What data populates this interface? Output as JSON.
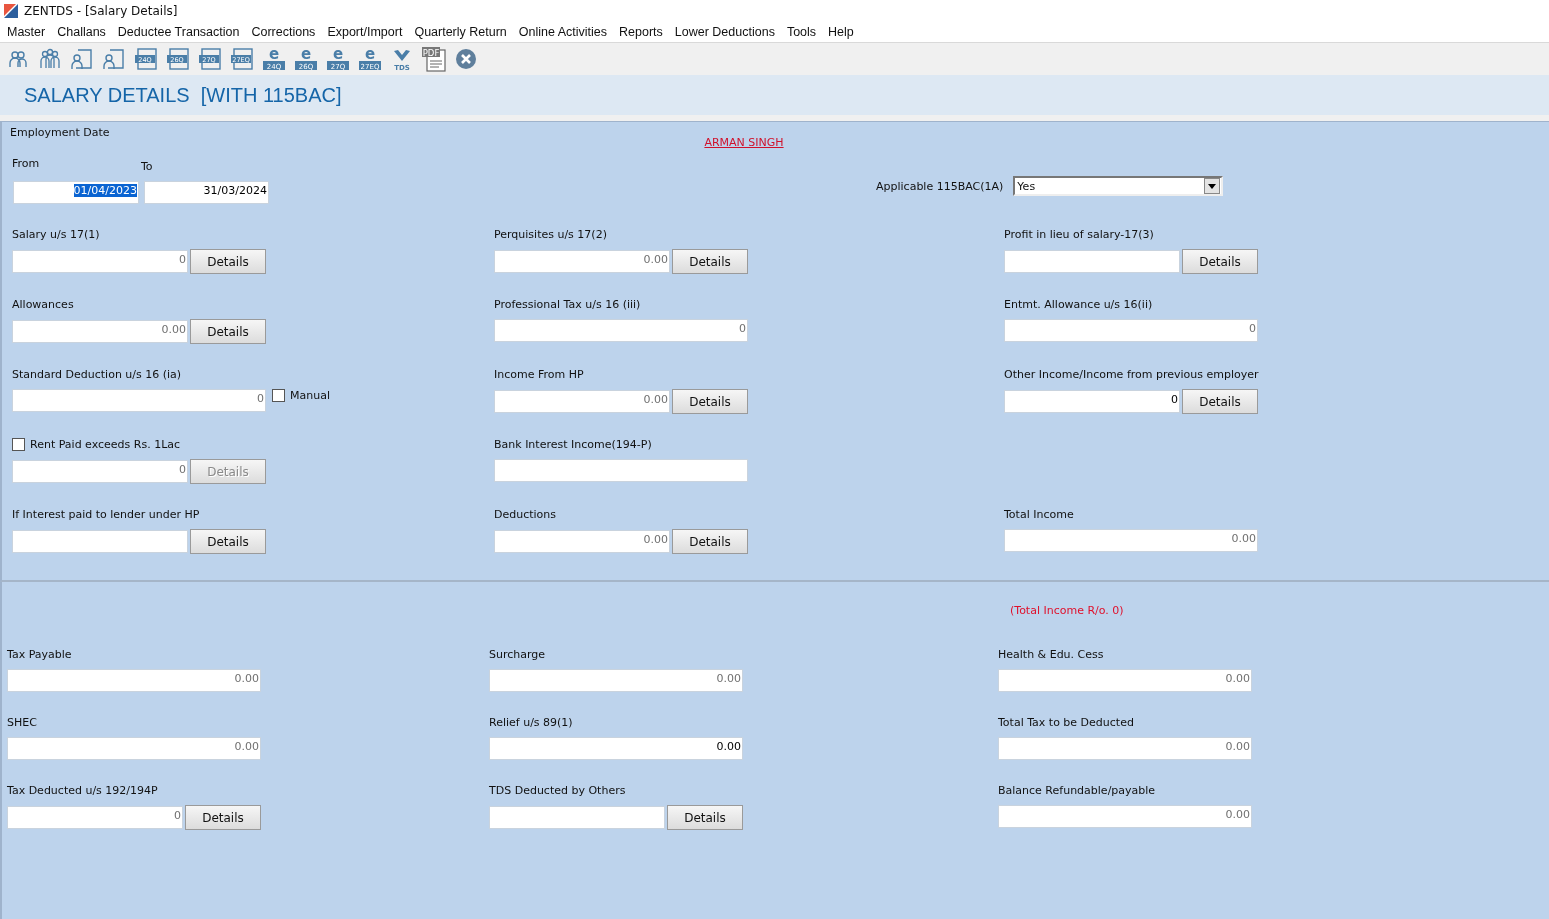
{
  "window": {
    "title": "ZENTDS - [Salary Details]"
  },
  "menu": [
    "Master",
    "Challans",
    "Deductee Transaction",
    "Corrections",
    "Export/Import",
    "Quarterly Return",
    "Online Activities",
    "Reports",
    "Lower Deductions",
    "Tools",
    "Help"
  ],
  "toolbar": [
    {
      "kind": "person"
    },
    {
      "kind": "group"
    },
    {
      "kind": "person-form"
    },
    {
      "kind": "person-form"
    },
    {
      "kind": "form",
      "label": "24Q"
    },
    {
      "kind": "form",
      "label": "26Q"
    },
    {
      "kind": "form",
      "label": "27Q"
    },
    {
      "kind": "form",
      "label": "27EQ"
    },
    {
      "kind": "e-form",
      "mark": "e",
      "label": "24Q"
    },
    {
      "kind": "e-form",
      "mark": "e",
      "label": "26Q"
    },
    {
      "kind": "e-form",
      "mark": "e",
      "label": "27Q"
    },
    {
      "kind": "e-form",
      "mark": "e",
      "label": "27EQ"
    },
    {
      "kind": "tds",
      "label": "TDS"
    },
    {
      "kind": "pdf",
      "label": "PDF"
    },
    {
      "kind": "close"
    }
  ],
  "banner": "SALARY DETAILS  [WITH 115BAC]",
  "employment": {
    "title": "Employment Date",
    "from_label": "From",
    "to_label": "To",
    "from": {
      "value": "01/04/2023",
      "selected": true
    },
    "to": {
      "value": "31/03/2024",
      "selected": false
    }
  },
  "deductee_name": "ARMAN SINGH",
  "applicable": {
    "label": "Applicable 115BAC(1A)",
    "value": "Yes"
  },
  "income_rows": [
    [
      {
        "kind": "amount",
        "label": "Salary u/s 17(1)",
        "value": "0",
        "greyed": true,
        "button": {
          "label": "Details",
          "disabled": false
        }
      },
      {
        "kind": "amount",
        "label": "Perquisites u/s 17(2)",
        "value": "0.00",
        "greyed": true,
        "button": {
          "label": "Details",
          "disabled": false
        }
      },
      {
        "kind": "amount",
        "label": "Profit in lieu of salary-17(3)",
        "button": {
          "label": "Details",
          "disabled": false
        }
      }
    ],
    [
      {
        "kind": "amount",
        "label": "Allowances",
        "value": "0.00",
        "greyed": true,
        "button": {
          "label": "Details",
          "disabled": false
        }
      },
      {
        "kind": "wide",
        "label": "Professional Tax u/s 16 (iii)",
        "value": "0",
        "greyed": true
      },
      {
        "kind": "wide",
        "label": "Entmt. Allowance u/s 16(ii)",
        "value": "0",
        "greyed": true
      }
    ],
    [
      {
        "kind": "wide",
        "label": "Standard Deduction u/s 16 (ia)",
        "value": "0",
        "greyed": true,
        "option": {
          "label": "Manual",
          "checked": false
        }
      },
      {
        "kind": "amount",
        "label": "Income From HP",
        "value": "0.00",
        "greyed": true,
        "button": {
          "label": "Details",
          "disabled": false
        }
      },
      {
        "kind": "amount",
        "label": "Other Income/Income from previous employer",
        "value": "0",
        "greyed": false,
        "button": {
          "label": "Details",
          "disabled": false
        }
      }
    ],
    [
      {
        "kind": "check-amount",
        "label": "Rent Paid exceeds Rs.  1Lac",
        "checked": false,
        "value": "0",
        "greyed": true,
        "button": {
          "label": "Details",
          "disabled": true
        }
      },
      {
        "kind": "wide",
        "label": "Bank Interest Income(194-P)"
      },
      {
        "kind": "empty"
      }
    ],
    [
      {
        "kind": "amount",
        "label": "If Interest paid to lender under HP",
        "button": {
          "label": "Details",
          "disabled": false
        }
      },
      {
        "kind": "amount",
        "label": "Deductions",
        "value": "0.00",
        "greyed": true,
        "button": {
          "label": "Details",
          "disabled": false
        }
      },
      {
        "kind": "wide",
        "label": "Total Income",
        "value": "0.00",
        "greyed": true
      }
    ]
  ],
  "rounded_note": "(Total Income R/o. 0)",
  "tax_rows": [
    [
      {
        "kind": "wide",
        "label": "Tax Payable",
        "value": "0.00",
        "greyed": true
      },
      {
        "kind": "wide",
        "label": "Surcharge",
        "value": "0.00",
        "greyed": true
      },
      {
        "kind": "wide",
        "label": "Health & Edu. Cess",
        "value": "0.00",
        "greyed": true
      }
    ],
    [
      {
        "kind": "wide",
        "label": "SHEC",
        "value": "0.00",
        "greyed": true
      },
      {
        "kind": "wide",
        "label": "Relief u/s 89(1)",
        "value": "0.00",
        "greyed": false
      },
      {
        "kind": "wide",
        "label": "Total Tax to be Deducted",
        "value": "0.00",
        "greyed": true
      }
    ],
    [
      {
        "kind": "amount",
        "label": "Tax Deducted u/s 192/194P",
        "value": "0",
        "greyed": true,
        "button": {
          "label": "Details",
          "disabled": false
        }
      },
      {
        "kind": "amount",
        "label": "TDS Deducted by Others",
        "button": {
          "label": "Details",
          "disabled": false
        }
      },
      {
        "kind": "wide",
        "label": "Balance Refundable/payable",
        "value": "0.00",
        "greyed": true
      }
    ]
  ]
}
